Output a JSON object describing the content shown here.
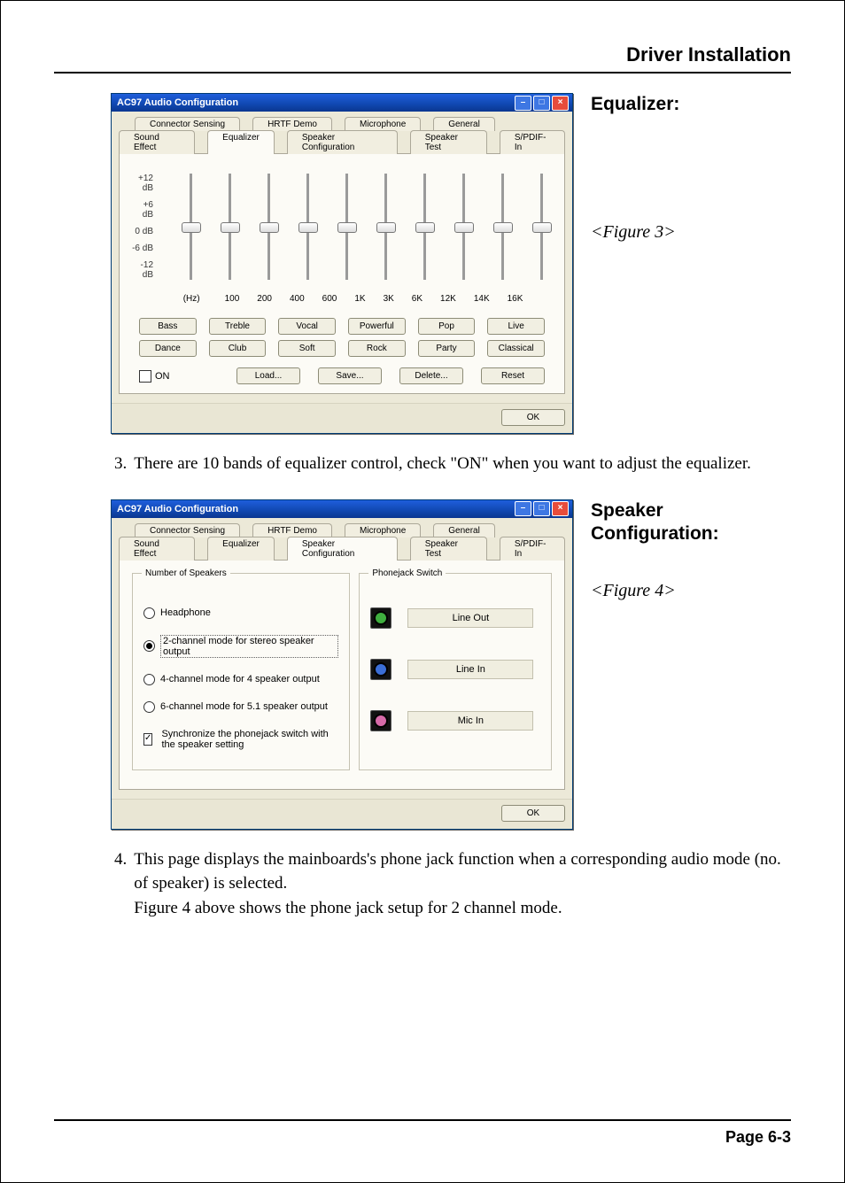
{
  "header": "Driver Installation",
  "footer": "Page 6-3",
  "section1": {
    "heading": "Equalizer:",
    "figlabel": "<Figure 3>",
    "paragraph_num": "3.",
    "paragraph": "There are 10 bands of equalizer control, check \"ON\" when you want to adjust the equalizer."
  },
  "section2": {
    "heading": "Speaker Configuration:",
    "figlabel": "<Figure 4>",
    "paragraph_num": "4.",
    "paragraph": "This page displays the mainboards's phone jack function when a corresponding audio mode (no. of speaker) is selected.\nFigure 4 above shows the phone jack setup for 2 channel mode."
  },
  "dialog": {
    "title": "AC97 Audio Configuration",
    "tabs_row1": [
      "Connector Sensing",
      "HRTF Demo",
      "Microphone",
      "General"
    ],
    "tabs_row2": [
      "Sound Effect",
      "Equalizer",
      "Speaker Configuration",
      "Speaker Test",
      "S/PDIF-In"
    ],
    "ok": "OK"
  },
  "equalizer": {
    "db_labels": [
      "+12 dB",
      "+6 dB",
      "0 dB",
      "-6 dB",
      "-12 dB"
    ],
    "hz_head": "(Hz)",
    "bands": [
      "100",
      "200",
      "400",
      "600",
      "1K",
      "3K",
      "6K",
      "12K",
      "14K",
      "16K"
    ],
    "presets_row1": [
      "Bass",
      "Treble",
      "Vocal",
      "Powerful",
      "Pop",
      "Live"
    ],
    "presets_row2": [
      "Dance",
      "Club",
      "Soft",
      "Rock",
      "Party",
      "Classical"
    ],
    "on": "ON",
    "load": "Load...",
    "save": "Save...",
    "delete": "Delete...",
    "reset": "Reset"
  },
  "speaker": {
    "left_legend": "Number of Speakers",
    "right_legend": "Phonejack Switch",
    "options": [
      {
        "label": "Headphone",
        "selected": false
      },
      {
        "label": "2-channel mode for stereo speaker output",
        "selected": true
      },
      {
        "label": "4-channel mode for 4 speaker output",
        "selected": false
      },
      {
        "label": "6-channel mode for 5.1 speaker output",
        "selected": false
      }
    ],
    "sync_label": "Synchronize the phonejack switch with the speaker setting",
    "sync_checked": true,
    "jacks": [
      {
        "color": "green",
        "label": "Line Out"
      },
      {
        "color": "blue",
        "label": "Line In"
      },
      {
        "color": "pink",
        "label": "Mic In"
      }
    ]
  }
}
